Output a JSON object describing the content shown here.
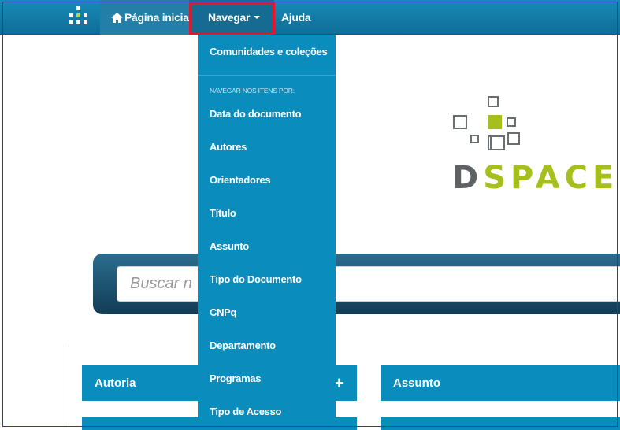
{
  "navbar": {
    "home_label": "Página inicial",
    "browse_label": "Navegar",
    "help_label": "Ajuda"
  },
  "dropdown": {
    "communities": "Comunidades e coleções",
    "browse_header": "NAVEGAR NOS ITENS POR:",
    "items": [
      "Data do documento",
      "Autores",
      "Orientadores",
      "Título",
      "Assunto",
      "Tipo do Documento",
      "CNPq",
      "Departamento",
      "Programas",
      "Tipo de Acesso"
    ]
  },
  "logo": {
    "text_d": "D",
    "text_rest": "SPACE"
  },
  "search": {
    "placeholder": "Buscar n"
  },
  "facets": {
    "left_title": "Autoria",
    "left_icon": "+",
    "right_title": "Assunto"
  },
  "colors": {
    "accent": "#0a8cbd",
    "logo_green": "#a7bf1c",
    "logo_gray": "#5f6264",
    "highlight": "#e3162b"
  }
}
